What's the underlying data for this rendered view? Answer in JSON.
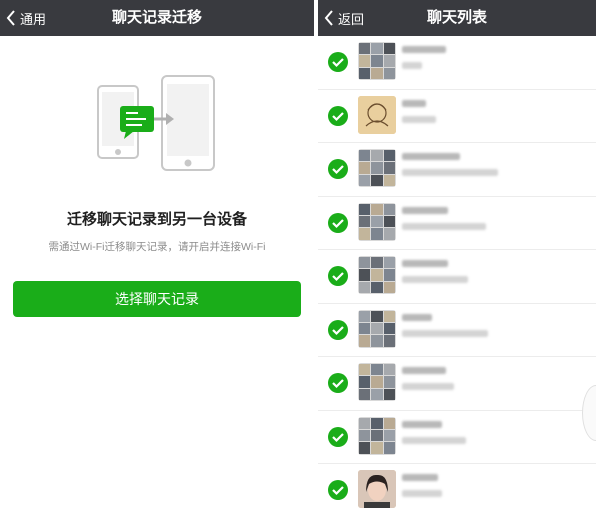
{
  "left_screen": {
    "nav": {
      "back_label": "通用",
      "title": "聊天记录迁移"
    },
    "heading": "迁移聊天记录到另一台设备",
    "subtext": "需通过Wi-Fi迁移聊天记录，请开启并连接Wi-Fi",
    "button_label": "选择聊天记录"
  },
  "right_screen": {
    "nav": {
      "back_label": "返回",
      "title": "聊天列表"
    },
    "rows": [
      {
        "selected": true,
        "avatar_type": "group-grid"
      },
      {
        "selected": true,
        "avatar_type": "illustration"
      },
      {
        "selected": true,
        "avatar_type": "group-grid"
      },
      {
        "selected": true,
        "avatar_type": "group-grid"
      },
      {
        "selected": true,
        "avatar_type": "group-grid"
      },
      {
        "selected": true,
        "avatar_type": "group-grid"
      },
      {
        "selected": true,
        "avatar_type": "group-grid"
      },
      {
        "selected": true,
        "avatar_type": "group-grid"
      },
      {
        "selected": true,
        "avatar_type": "portrait-photo"
      }
    ]
  },
  "colors": {
    "nav_bar": "#393a3f",
    "accent_green": "#1aad19",
    "subtext_gray": "#8c8c8c"
  },
  "icons": [
    "back-chevron-icon",
    "phone-transfer-illustration",
    "message-bubble-icon",
    "arrow-right-icon",
    "checkmark-icon"
  ]
}
